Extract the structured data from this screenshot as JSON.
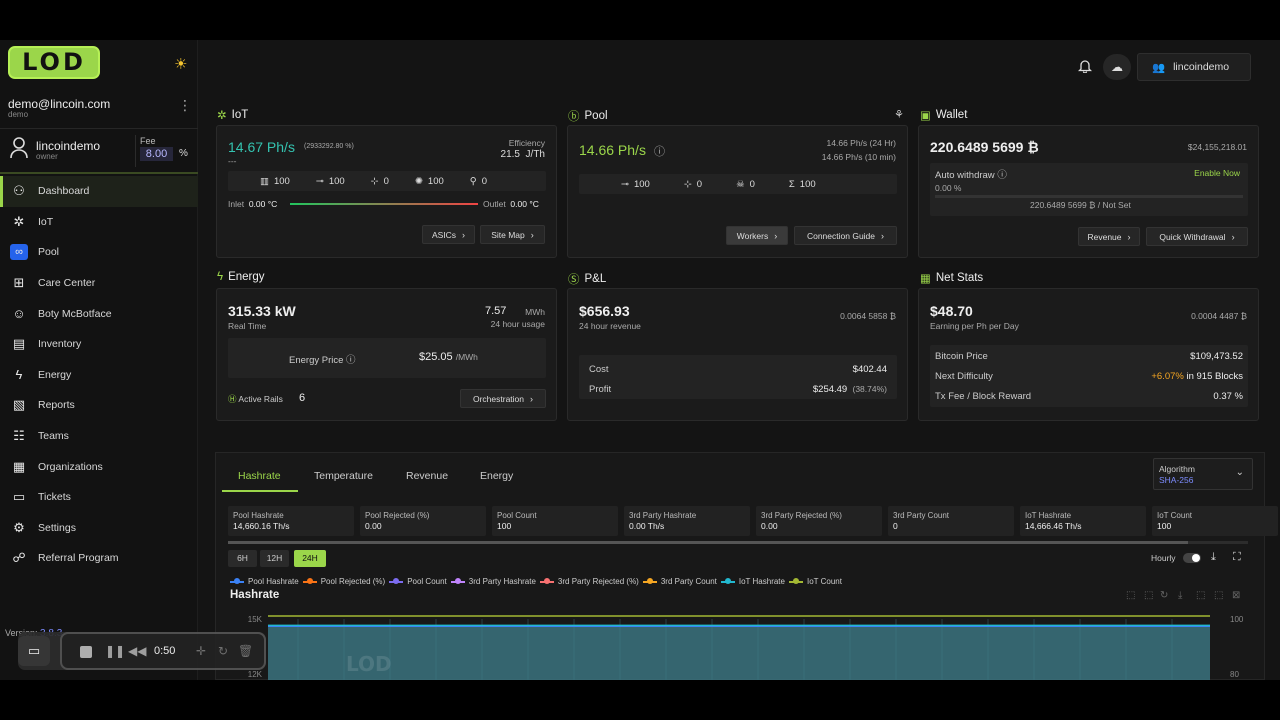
{
  "brand": {
    "logo": "LOD"
  },
  "account": {
    "email": "demo@lincoin.com",
    "sub": "demo",
    "user": "lincoindemo",
    "role": "owner",
    "fee_label": "Fee",
    "fee_value": "8.00",
    "fee_unit": "%"
  },
  "nav": [
    {
      "label": "Dashboard",
      "icon": "dashboard-icon",
      "glyph": "⚇"
    },
    {
      "label": "IoT",
      "icon": "iot-icon",
      "glyph": "✲"
    },
    {
      "label": "Pool",
      "icon": "pool-icon",
      "glyph": "∞"
    },
    {
      "label": "Care Center",
      "icon": "care-center-icon",
      "glyph": "⊞"
    },
    {
      "label": "Boty McBotface",
      "icon": "bot-icon",
      "glyph": "☺"
    },
    {
      "label": "Inventory",
      "icon": "inventory-icon",
      "glyph": "▤"
    },
    {
      "label": "Energy",
      "icon": "energy-icon",
      "glyph": "ϟ"
    },
    {
      "label": "Reports",
      "icon": "reports-icon",
      "glyph": "▧"
    },
    {
      "label": "Teams",
      "icon": "teams-icon",
      "glyph": "☷"
    },
    {
      "label": "Organizations",
      "icon": "organizations-icon",
      "glyph": "▦"
    },
    {
      "label": "Tickets",
      "icon": "tickets-icon",
      "glyph": "▭"
    },
    {
      "label": "Settings",
      "icon": "settings-icon",
      "glyph": "⚙"
    },
    {
      "label": "Referral Program",
      "icon": "referral-icon",
      "glyph": "☍"
    }
  ],
  "version": {
    "label": "Version:",
    "value": "3.8.3"
  },
  "recorder": {
    "time": "0:50"
  },
  "topbar": {
    "user": "lincoindemo"
  },
  "iot": {
    "title": "IoT",
    "hashrate": "14.67 Ph/s",
    "pct": "(2933292.80 %)",
    "dash": "---",
    "eff_label": "Efficiency",
    "eff_value": "21.5",
    "eff_unit": "J/Th",
    "stats": [
      "100",
      "100",
      "0",
      "100",
      "0"
    ],
    "inlet_label": "Inlet",
    "inlet": "0.00 °C",
    "outlet_label": "Outlet",
    "outlet": "0.00 °C",
    "btn_asics": "ASICs",
    "btn_sitemap": "Site Map"
  },
  "pool": {
    "title": "Pool",
    "hashrate": "14.66 Ph/s",
    "h24": "14.66 Ph/s",
    "h24_lbl": "(24 Hr)",
    "h10": "14.66 Ph/s",
    "h10_lbl": "(10 min)",
    "stats": [
      "100",
      "0",
      "0",
      "100"
    ],
    "btn_workers": "Workers",
    "btn_guide": "Connection Guide"
  },
  "wallet": {
    "title": "Wallet",
    "balance": "220.6489 5699 ₿",
    "usd": "$24,155,218.01",
    "auto_label": "Auto withdraw",
    "enable": "Enable Now",
    "auto_pct": "0.00 %",
    "progress": 0,
    "threshold": "220.6489 5699 ₿ / Not Set",
    "btn_revenue": "Revenue",
    "btn_quick": "Quick Withdrawal"
  },
  "energy": {
    "title": "Energy",
    "power": "315.33 kW",
    "power_lbl": "Real Time",
    "usage": "7.57",
    "usage_unit": "MWh",
    "usage_lbl": "24 hour usage",
    "price_lbl": "Energy Price",
    "price": "$25.05",
    "price_unit": "/MWh",
    "rails_lbl": "Active Rails",
    "rails": "6",
    "btn_orch": "Orchestration"
  },
  "pnl": {
    "title": "P&L",
    "revenue": "$656.93",
    "revenue_lbl": "24 hour revenue",
    "btc": "0.0064 5858  ₿",
    "cost_lbl": "Cost",
    "cost": "$402.44",
    "profit_lbl": "Profit",
    "profit": "$254.49",
    "profit_pct": "(38.74%)"
  },
  "netstats": {
    "title": "Net Stats",
    "earn": "$48.70",
    "earn_lbl": "Earning per Ph per Day",
    "btc": "0.0004 4487  ₿",
    "price_lbl": "Bitcoin Price",
    "price": "$109,473.52",
    "diff_lbl": "Next Difficulty",
    "diff_pct": "+6.07%",
    "diff_blocks": "in 915 Blocks",
    "fee_lbl": "Tx Fee / Block Reward",
    "fee": "0.37 %"
  },
  "chart": {
    "tabs": [
      "Hashrate",
      "Temperature",
      "Revenue",
      "Energy"
    ],
    "algo_lbl": "Algorithm",
    "algo": "SHA-256",
    "metrics": [
      {
        "label": "Pool Hashrate",
        "value": "14,660.16 Th/s"
      },
      {
        "label": "Pool Rejected (%)",
        "value": "0.00"
      },
      {
        "label": "Pool Count",
        "value": "100"
      },
      {
        "label": "3rd Party Hashrate",
        "value": "0.00 Th/s"
      },
      {
        "label": "3rd Party Rejected (%)",
        "value": "0.00"
      },
      {
        "label": "3rd Party Count",
        "value": "0"
      },
      {
        "label": "IoT Hashrate",
        "value": "14,666.46 Th/s"
      },
      {
        "label": "IoT Count",
        "value": "100"
      }
    ],
    "ranges": [
      "6H",
      "12H",
      "24H"
    ],
    "hourly": "Hourly",
    "title": "Hashrate",
    "legend": [
      {
        "name": "Pool Hashrate",
        "color": "#3b82f6"
      },
      {
        "name": "Pool Rejected (%)",
        "color": "#f97316"
      },
      {
        "name": "Pool Count",
        "color": "#7c6cf0"
      },
      {
        "name": "3rd Party Hashrate",
        "color": "#c084fc"
      },
      {
        "name": "3rd Party Rejected (%)",
        "color": "#f87171"
      },
      {
        "name": "3rd Party Count",
        "color": "#f5a623"
      },
      {
        "name": "IoT Hashrate",
        "color": "#22b8cf"
      },
      {
        "name": "IoT Count",
        "color": "#a3b833"
      }
    ],
    "y_left": [
      "15K",
      "12K"
    ],
    "y_right": [
      "100",
      "80"
    ],
    "watermark": "LOD"
  },
  "chart_data": {
    "type": "area",
    "title": "Hashrate",
    "series": [
      {
        "name": "Pool Hashrate",
        "values": [
          14660,
          14660,
          14660
        ]
      },
      {
        "name": "IoT Hashrate",
        "values": [
          14666,
          14666,
          14666
        ]
      },
      {
        "name": "Pool Count",
        "values": [
          100,
          100,
          100
        ]
      }
    ],
    "ylim_left": [
      12000,
      15000
    ],
    "ylim_right": [
      80,
      100
    ]
  }
}
